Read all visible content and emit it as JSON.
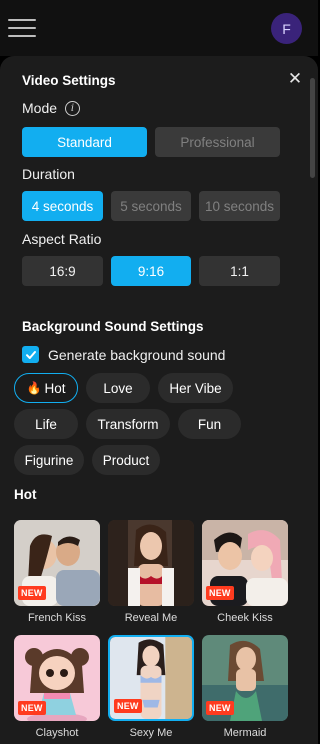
{
  "header": {
    "avatar_letter": "F",
    "menu_icon": "menu-icon"
  },
  "video_settings": {
    "title": "Video Settings",
    "mode_label": "Mode",
    "modes": [
      "Standard",
      "Professional"
    ],
    "selected_mode": "Standard",
    "duration_label": "Duration",
    "durations": [
      "4 seconds",
      "5 seconds",
      "10 seconds"
    ],
    "selected_duration": "4 seconds",
    "aspect_label": "Aspect Ratio",
    "aspects": [
      "16:9",
      "9:16",
      "1:1"
    ],
    "selected_aspect": "9:16"
  },
  "sound": {
    "title": "Background Sound Settings",
    "checkbox_label": "Generate background sound",
    "checked": true
  },
  "categories": {
    "items": [
      "Hot",
      "Love",
      "Her Vibe",
      "Life",
      "Transform",
      "Fun",
      "Figurine",
      "Product"
    ],
    "selected": "Hot",
    "hot_prefix_icon": "fire-icon"
  },
  "hot_section": {
    "title": "Hot",
    "badge": "NEW",
    "cards": [
      "French Kiss",
      "Reveal Me",
      "Cheek Kiss",
      "Clayshot",
      "Sexy Me",
      "Mermaid"
    ],
    "selected_card": "Sexy Me"
  },
  "colors": {
    "accent": "#12aef0",
    "badge": "#ff3b1f",
    "panel": "#1c1c1c",
    "avatar": "#3a237a"
  }
}
